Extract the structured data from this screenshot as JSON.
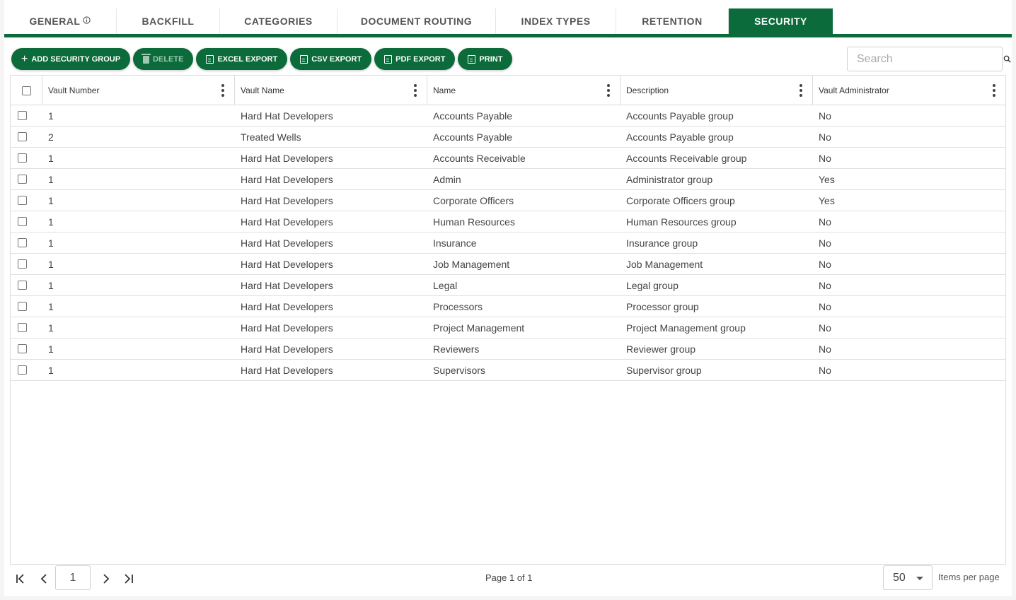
{
  "tabs": [
    {
      "label": "General",
      "info_icon": "info-circle-icon",
      "active": false
    },
    {
      "label": "Backfill",
      "active": false
    },
    {
      "label": "Categories",
      "active": false
    },
    {
      "label": "Document Routing",
      "active": false
    },
    {
      "label": "Index Types",
      "active": false
    },
    {
      "label": "Retention",
      "active": false
    },
    {
      "label": "Security",
      "active": true
    }
  ],
  "colors": {
    "accent": "#0b6b3a"
  },
  "toolbar": {
    "add_label": "Add Security Group",
    "delete_label": "Delete",
    "excel_label": "Excel Export",
    "csv_label": "CSV Export",
    "pdf_label": "PDF Export",
    "print_label": "Print"
  },
  "search": {
    "placeholder": "Search",
    "value": ""
  },
  "columns": [
    "Vault Number",
    "Vault Name",
    "Name",
    "Description",
    "Vault Administrator"
  ],
  "rows": [
    [
      "1",
      "Hard Hat Developers",
      "Accounts Payable",
      "Accounts Payable group",
      "No"
    ],
    [
      "2",
      "Treated Wells",
      "Accounts Payable",
      "Accounts Payable group",
      "No"
    ],
    [
      "1",
      "Hard Hat Developers",
      "Accounts Receivable",
      "Accounts Receivable group",
      "No"
    ],
    [
      "1",
      "Hard Hat Developers",
      "Admin",
      "Administrator group",
      "Yes"
    ],
    [
      "1",
      "Hard Hat Developers",
      "Corporate Officers",
      "Corporate Officers group",
      "Yes"
    ],
    [
      "1",
      "Hard Hat Developers",
      "Human Resources",
      "Human Resources group",
      "No"
    ],
    [
      "1",
      "Hard Hat Developers",
      "Insurance",
      "Insurance group",
      "No"
    ],
    [
      "1",
      "Hard Hat Developers",
      "Job Management",
      "Job Management",
      "No"
    ],
    [
      "1",
      "Hard Hat Developers",
      "Legal",
      "Legal group",
      "No"
    ],
    [
      "1",
      "Hard Hat Developers",
      "Processors",
      "Processor group",
      "No"
    ],
    [
      "1",
      "Hard Hat Developers",
      "Project Management",
      "Project Management group",
      "No"
    ],
    [
      "1",
      "Hard Hat Developers",
      "Reviewers",
      "Reviewer group",
      "No"
    ],
    [
      "1",
      "Hard Hat Developers",
      "Supervisors",
      "Supervisor group",
      "No"
    ]
  ],
  "pager": {
    "current_page": "1",
    "page_info": "Page 1 of 1",
    "per_page": "50",
    "per_page_label": "Items per page"
  }
}
